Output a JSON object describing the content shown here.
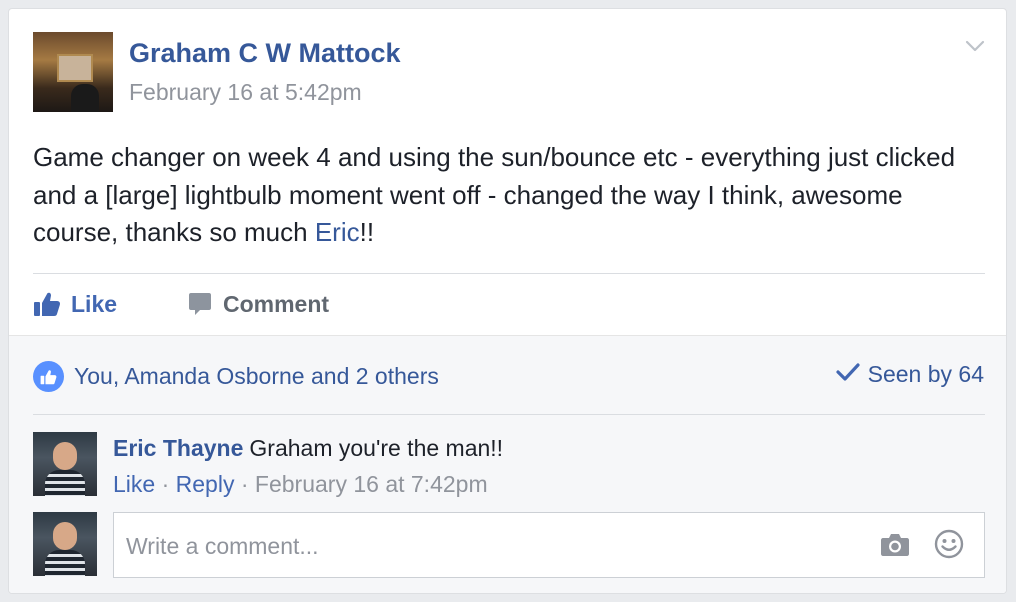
{
  "post": {
    "author": "Graham C W Mattock",
    "timestamp": "February 16 at 5:42pm",
    "text_part1": "Game changer on week 4 and using the sun/bounce etc - everything just clicked and a [large] lightbulb moment went off - changed the way I think, awesome course, thanks so much ",
    "mention": "Eric",
    "text_part2": "!!"
  },
  "actions": {
    "like_label": "Like",
    "comment_label": "Comment"
  },
  "feedback": {
    "likes_text": "You, Amanda Osborne and 2 others",
    "seen_text": "Seen by 64"
  },
  "comments": [
    {
      "author": "Eric Thayne",
      "text": "Graham you're the man!!",
      "like_label": "Like",
      "separator": " · ",
      "reply_label": "Reply",
      "timestamp": "February 16 at 7:42pm"
    }
  ],
  "composer": {
    "placeholder": "Write a comment..."
  },
  "icons": {
    "options": "chevron-down-icon",
    "like": "thumbs-up-icon",
    "comment": "comment-bubble-icon",
    "likes_badge": "like-badge-icon",
    "seen": "checkmark-icon",
    "camera": "camera-icon",
    "emoji": "smiley-icon"
  },
  "colors": {
    "link_blue": "#365899",
    "action_blue": "#4267b2",
    "like_badge": "#5890ff",
    "muted": "#90949c",
    "text": "#1d2129",
    "background": "#e9ebee"
  }
}
